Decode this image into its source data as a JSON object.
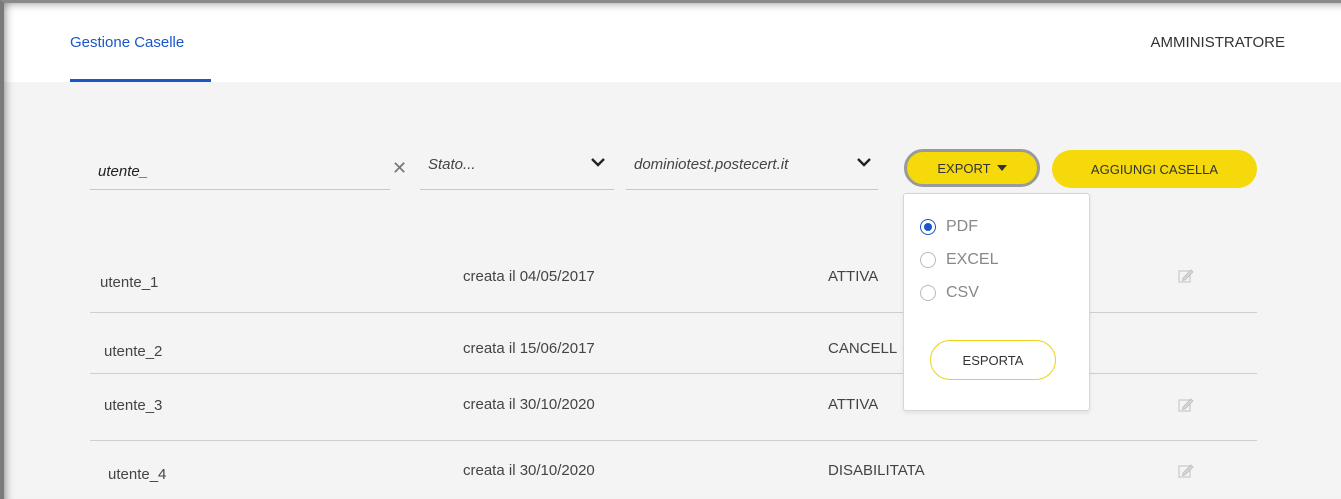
{
  "header": {
    "tab_label": "Gestione Caselle",
    "user_label": "AMMINISTRATORE"
  },
  "filters": {
    "search_value": "utente_",
    "stato_placeholder": "Stato...",
    "domain_value": "dominiotest.postecert.it"
  },
  "toolbar": {
    "export_label": "EXPORT",
    "add_label": "AGGIUNGI CASELLA"
  },
  "export_menu": {
    "options": [
      {
        "label": "PDF",
        "checked": true
      },
      {
        "label": "EXCEL",
        "checked": false
      },
      {
        "label": "CSV",
        "checked": false
      }
    ],
    "confirm_label": "ESPORTA"
  },
  "table": {
    "rows": [
      {
        "user": "utente_1",
        "created": "creata il 04/05/2017",
        "state": "ATTIVA",
        "editable": true
      },
      {
        "user": "utente_2",
        "created": "creata il 15/06/2017",
        "state": "CANCELL",
        "editable": false
      },
      {
        "user": "utente_3",
        "created": "creata il 30/10/2020",
        "state": "ATTIVA",
        "editable": true
      },
      {
        "user": "utente_4",
        "created": "creata il 30/10/2020",
        "state": "DISABILITATA",
        "editable": true
      }
    ]
  },
  "colors": {
    "accent_blue": "#1a56c9",
    "button_yellow": "#f5d90a"
  }
}
